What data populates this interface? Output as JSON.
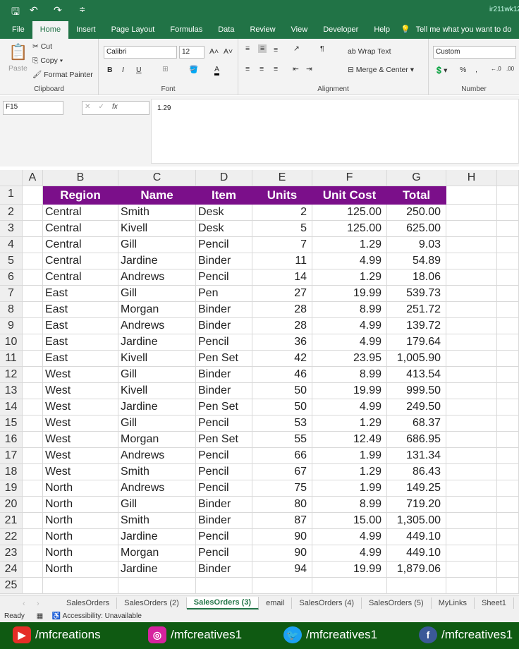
{
  "title_bar": {
    "doc": "ir211wk12"
  },
  "ribbon_tabs": [
    "File",
    "Home",
    "Insert",
    "Page Layout",
    "Formulas",
    "Data",
    "Review",
    "View",
    "Developer",
    "Help"
  ],
  "tell_me": "Tell me what you want to do",
  "clipboard": {
    "paste": "Paste",
    "cut": "Cut",
    "copy": "Copy",
    "format_painter": "Format Painter",
    "label": "Clipboard"
  },
  "font": {
    "name": "Calibri",
    "size": "12",
    "label": "Font",
    "bold": "B",
    "italic": "I",
    "underline": "U"
  },
  "alignment": {
    "wrap": "Wrap Text",
    "merge": "Merge & Center",
    "label": "Alignment"
  },
  "number": {
    "format": "Custom",
    "label": "Number",
    "percent": "%",
    "comma": ","
  },
  "formula_bar": {
    "name_box": "F15",
    "fx": "fx",
    "value": "1.29"
  },
  "columns": [
    "A",
    "B",
    "C",
    "D",
    "E",
    "F",
    "G",
    "H"
  ],
  "headers": [
    "Region",
    "Name",
    "Item",
    "Units",
    "Unit Cost",
    "Total"
  ],
  "rows": [
    [
      "Central",
      "Smith",
      "Desk",
      "2",
      "125.00",
      "250.00"
    ],
    [
      "Central",
      "Kivell",
      "Desk",
      "5",
      "125.00",
      "625.00"
    ],
    [
      "Central",
      "Gill",
      "Pencil",
      "7",
      "1.29",
      "9.03"
    ],
    [
      "Central",
      "Jardine",
      "Binder",
      "11",
      "4.99",
      "54.89"
    ],
    [
      "Central",
      "Andrews",
      "Pencil",
      "14",
      "1.29",
      "18.06"
    ],
    [
      "East",
      "Gill",
      "Pen",
      "27",
      "19.99",
      "539.73"
    ],
    [
      "East",
      "Morgan",
      "Binder",
      "28",
      "8.99",
      "251.72"
    ],
    [
      "East",
      "Andrews",
      "Binder",
      "28",
      "4.99",
      "139.72"
    ],
    [
      "East",
      "Jardine",
      "Pencil",
      "36",
      "4.99",
      "179.64"
    ],
    [
      "East",
      "Kivell",
      "Pen Set",
      "42",
      "23.95",
      "1,005.90"
    ],
    [
      "West",
      "Gill",
      "Binder",
      "46",
      "8.99",
      "413.54"
    ],
    [
      "West",
      "Kivell",
      "Binder",
      "50",
      "19.99",
      "999.50"
    ],
    [
      "West",
      "Jardine",
      "Pen Set",
      "50",
      "4.99",
      "249.50"
    ],
    [
      "West",
      "Gill",
      "Pencil",
      "53",
      "1.29",
      "68.37"
    ],
    [
      "West",
      "Morgan",
      "Pen Set",
      "55",
      "12.49",
      "686.95"
    ],
    [
      "West",
      "Andrews",
      "Pencil",
      "66",
      "1.99",
      "131.34"
    ],
    [
      "West",
      "Smith",
      "Pencil",
      "67",
      "1.29",
      "86.43"
    ],
    [
      "North",
      "Andrews",
      "Pencil",
      "75",
      "1.99",
      "149.25"
    ],
    [
      "North",
      "Gill",
      "Binder",
      "80",
      "8.99",
      "719.20"
    ],
    [
      "North",
      "Smith",
      "Binder",
      "87",
      "15.00",
      "1,305.00"
    ],
    [
      "North",
      "Jardine",
      "Pencil",
      "90",
      "4.99",
      "449.10"
    ],
    [
      "North",
      "Morgan",
      "Pencil",
      "90",
      "4.99",
      "449.10"
    ],
    [
      "North",
      "Jardine",
      "Binder",
      "94",
      "19.99",
      "1,879.06"
    ]
  ],
  "sheet_tabs": [
    "SalesOrders",
    "SalesOrders (2)",
    "SalesOrders (3)",
    "email",
    "SalesOrders (4)",
    "SalesOrders (5)",
    "MyLinks",
    "Sheet1"
  ],
  "active_sheet": 2,
  "status": {
    "ready": "Ready",
    "accessibility": "Accessibility: Unavailable"
  },
  "social": [
    {
      "icon": "youtube-icon",
      "handle": "/mfcreations",
      "color": "#e52d27",
      "glyph": "▶"
    },
    {
      "icon": "instagram-icon",
      "handle": "/mfcreatives1",
      "color": "#d6249f",
      "glyph": "◎"
    },
    {
      "icon": "twitter-icon",
      "handle": "/mfcreatives1",
      "color": "#1da1f2",
      "glyph": "🐦"
    },
    {
      "icon": "facebook-icon",
      "handle": "/mfcreatives1",
      "color": "#3b5998",
      "glyph": "f"
    }
  ],
  "colors": {
    "excel_green": "#217346",
    "header_fill": "#7b0f8a",
    "footer": "#0f5a12"
  }
}
